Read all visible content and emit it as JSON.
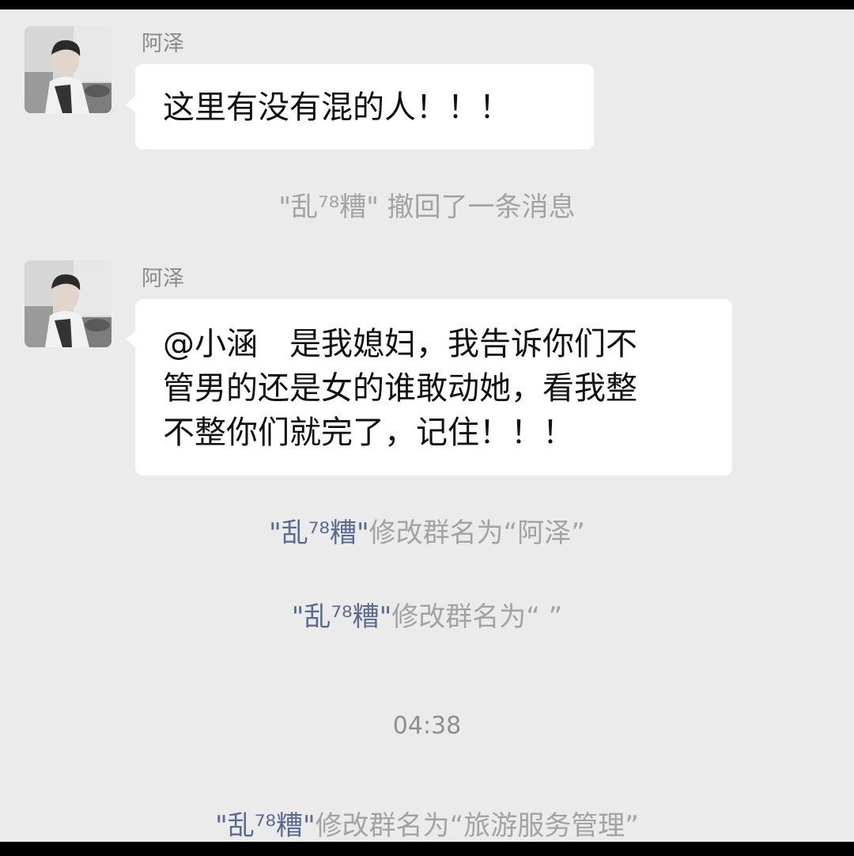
{
  "chat": {
    "messages": [
      {
        "sender": "阿泽",
        "text": "这里有没有混的人！！！"
      },
      {
        "sender": "阿泽",
        "text": "@小涵　是我媳妇，我告诉你们不\n管男的还是女的谁敢动她，看我整\n不整你们就完了，记住！！！"
      }
    ],
    "system_notices": [
      {
        "name": "\"乱⁷⁸糟\"",
        "action": " 撤回了一条消息"
      },
      {
        "name": "\"乱⁷⁸糟\"",
        "action": "修改群名为“阿泽”"
      },
      {
        "name": "\"乱⁷⁸糟\"",
        "action": "修改群名为“ ”"
      },
      {
        "name": "\"乱⁷⁸糟\"",
        "action": "修改群名为“旅游服务管理”"
      }
    ],
    "timestamp": "04:38"
  },
  "colors": {
    "background": "#ebebeb",
    "bubble": "#ffffff",
    "system_text": "#a3a3a3",
    "system_name": "#5b6a8e"
  },
  "icons": {
    "avatar": "user-avatar-photo"
  }
}
